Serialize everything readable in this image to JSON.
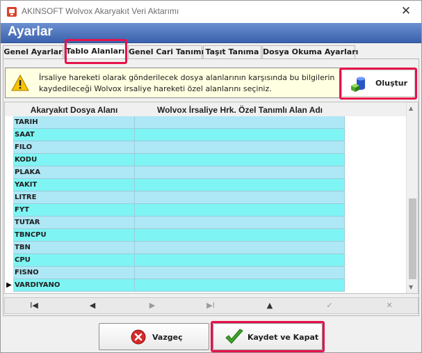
{
  "window": {
    "title": "AKINSOFT Wolvox Akaryakıt Veri Aktarımı",
    "close_glyph": "✕"
  },
  "header": {
    "title": "Ayarlar"
  },
  "tabs": [
    {
      "label": "Genel Ayarlar",
      "active": false
    },
    {
      "label": "Tablo Alanları",
      "active": true
    },
    {
      "label": "Genel Cari Tanımı",
      "active": false
    },
    {
      "label": "Taşıt Tanıma",
      "active": false
    },
    {
      "label": "Dosya Okuma Ayarları",
      "active": false
    }
  ],
  "info": {
    "text": "İrsaliye hareketi olarak gönderilecek dosya alanlarının karşısında bu bilgilerin kaydedileceği Wolvox irsaliye hareketi özel alanlarını seçiniz.",
    "icon": "warning-icon"
  },
  "olustur_button": {
    "label": "Oluştur",
    "icon": "database-cube-icon"
  },
  "grid": {
    "columns": [
      "Akaryakıt Dosya Alanı",
      "Wolvox İrsaliye Hrk. Özel Tanımlı Alan Adı"
    ],
    "rows": [
      {
        "field": "TARIH",
        "value": ""
      },
      {
        "field": "SAAT",
        "value": ""
      },
      {
        "field": "FILO",
        "value": ""
      },
      {
        "field": "KODU",
        "value": ""
      },
      {
        "field": "PLAKA",
        "value": ""
      },
      {
        "field": "YAKIT",
        "value": ""
      },
      {
        "field": "LITRE",
        "value": ""
      },
      {
        "field": "FYT",
        "value": ""
      },
      {
        "field": "TUTAR",
        "value": ""
      },
      {
        "field": "TBNCPU",
        "value": ""
      },
      {
        "field": "TBN",
        "value": ""
      },
      {
        "field": "CPU",
        "value": ""
      },
      {
        "field": "FISNO",
        "value": ""
      },
      {
        "field": "VARDIYANO",
        "value": ""
      }
    ],
    "current_row_indicator": "▶",
    "current_row": 13
  },
  "navigator": {
    "first": "I◀",
    "prior": "◀",
    "next": "▶",
    "last": "▶I",
    "insert": "▲",
    "post": "✓",
    "cancel": "✕"
  },
  "buttons": {
    "cancel_label": "Vazgeç",
    "save_label": "Kaydet ve Kapat"
  },
  "colors": {
    "header_blue": "#3a61ad",
    "row_light_blue": "#aee7f5",
    "row_cyan": "#7ff4f4",
    "highlight_red": "#e5134b",
    "info_bg": "#ffffe1"
  }
}
